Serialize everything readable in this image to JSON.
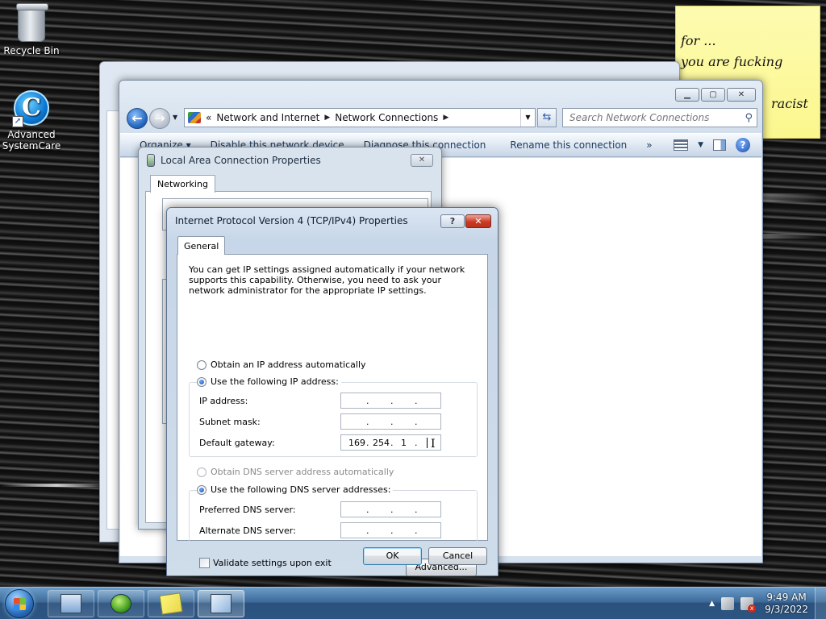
{
  "desktop": {
    "icons": [
      {
        "label": "Recycle Bin"
      },
      {
        "label": "Advanced SystemCare"
      }
    ],
    "sticky_note": {
      "lines": [
        "for ...",
        "you are fucking",
        "racist"
      ]
    }
  },
  "explorer": {
    "address": {
      "prev": "«",
      "crumbs": [
        "Network and Internet",
        "Network Connections"
      ]
    },
    "search_placeholder": "Search Network Connections",
    "commands": [
      "Organize ▾",
      "Disable this network device",
      "Diagnose this connection",
      "Rename this connection",
      "»"
    ]
  },
  "lac_properties": {
    "title": "Local Area Connection Properties",
    "tab": "Networking"
  },
  "ipv4_dialog": {
    "title": "Internet Protocol Version 4 (TCP/IPv4) Properties",
    "help_label": "?",
    "close_label": "✕",
    "tab": "General",
    "description": "You can get IP settings assigned automatically if your network supports this capability. Otherwise, you need to ask your network administrator for the appropriate IP settings.",
    "ip_auto_label": "Obtain an IP address automatically",
    "ip_manual_label": "Use the following IP address:",
    "ip_fields": {
      "ip_address": {
        "label": "IP address:",
        "octets": [
          "",
          "",
          "",
          ""
        ]
      },
      "subnet_mask": {
        "label": "Subnet mask:",
        "octets": [
          "",
          "",
          "",
          ""
        ]
      },
      "default_gateway": {
        "label": "Default gateway:",
        "octets": [
          "169",
          "254",
          "1",
          ""
        ]
      }
    },
    "dns_auto_label": "Obtain DNS server address automatically",
    "dns_manual_label": "Use the following DNS server addresses:",
    "dns_fields": {
      "preferred": {
        "label": "Preferred DNS server:",
        "octets": [
          "",
          "",
          "",
          ""
        ]
      },
      "alternate": {
        "label": "Alternate DNS server:",
        "octets": [
          "",
          "",
          "",
          ""
        ]
      }
    },
    "validate_label": "Validate settings upon exit",
    "advanced_label": "Advanced...",
    "ok_label": "OK",
    "cancel_label": "Cancel"
  },
  "taskbar": {
    "time": "9:49 AM",
    "date": "9/3/2022"
  }
}
